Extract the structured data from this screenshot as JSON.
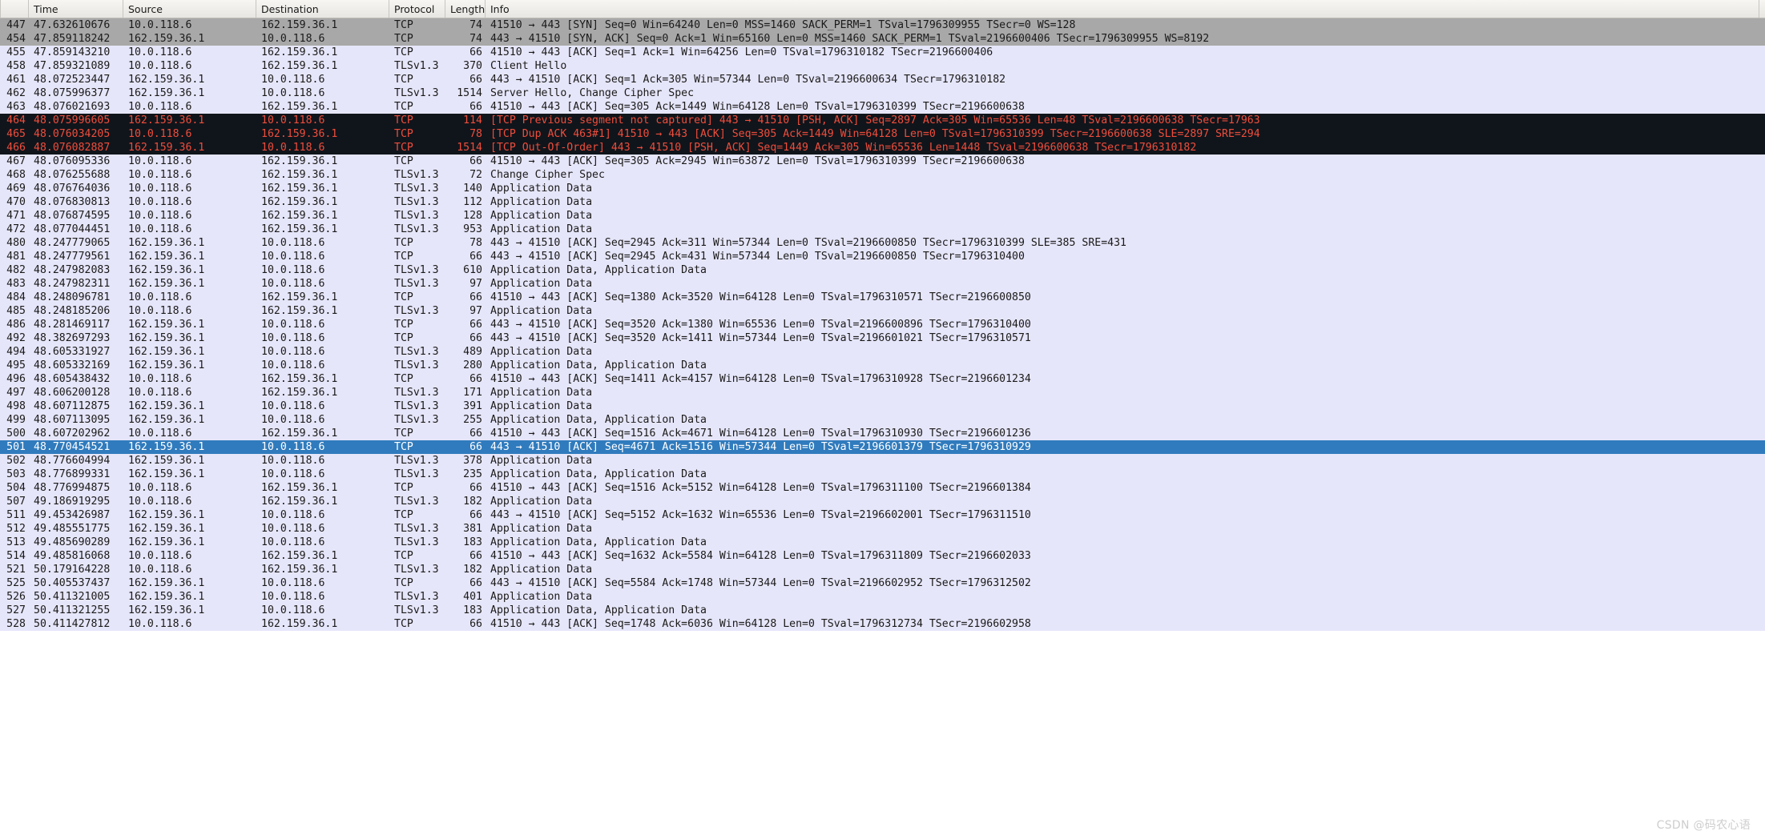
{
  "footer_watermark": "CSDN @码农心语",
  "colors": {
    "default_even": "#ffffff",
    "default_odd": "#ffffff",
    "selected_bg": "#307bbd",
    "selected_fg": "#ffffff",
    "tcp_syn_bg": "#a8a8a8",
    "tcp_syn_fg": "#1a1a1a",
    "tls_bg": "#e6e6fa",
    "tls_fg": "#1a1a1a",
    "tcp_ack_bg": "#e6e6fa",
    "tcp_ack_fg": "#1a1a1a",
    "tcp_err_bg": "#10151b",
    "tcp_err_fg": "#ef4d3c"
  },
  "columns": [
    {
      "label": "",
      "cls": "col-no"
    },
    {
      "label": "Time",
      "cls": "col-time"
    },
    {
      "label": "Source",
      "cls": "col-src"
    },
    {
      "label": "Destination",
      "cls": "col-dst"
    },
    {
      "label": "Protocol",
      "cls": "col-proto"
    },
    {
      "label": "Length",
      "cls": "col-len"
    },
    {
      "label": "Info",
      "cls": "col-info"
    }
  ],
  "packets": [
    {
      "no": 447,
      "time": "47.632610676",
      "src": "10.0.118.6",
      "dst": "162.159.36.1",
      "proto": "TCP",
      "len": 74,
      "info": "41510 → 443 [SYN] Seq=0 Win=64240 Len=0 MSS=1460 SACK_PERM=1 TSval=1796309955 TSecr=0 WS=128",
      "style": "syn"
    },
    {
      "no": 454,
      "time": "47.859118242",
      "src": "162.159.36.1",
      "dst": "10.0.118.6",
      "proto": "TCP",
      "len": 74,
      "info": "443 → 41510 [SYN, ACK] Seq=0 Ack=1 Win=65160 Len=0 MSS=1460 SACK_PERM=1 TSval=2196600406 TSecr=1796309955 WS=8192",
      "style": "syn"
    },
    {
      "no": 455,
      "time": "47.859143210",
      "src": "10.0.118.6",
      "dst": "162.159.36.1",
      "proto": "TCP",
      "len": 66,
      "info": "41510 → 443 [ACK] Seq=1 Ack=1 Win=64256 Len=0 TSval=1796310182 TSecr=2196600406",
      "style": "ack"
    },
    {
      "no": 458,
      "time": "47.859321089",
      "src": "10.0.118.6",
      "dst": "162.159.36.1",
      "proto": "TLSv1.3",
      "len": 370,
      "info": "Client Hello",
      "style": "tls"
    },
    {
      "no": 461,
      "time": "48.072523447",
      "src": "162.159.36.1",
      "dst": "10.0.118.6",
      "proto": "TCP",
      "len": 66,
      "info": "443 → 41510 [ACK] Seq=1 Ack=305 Win=57344 Len=0 TSval=2196600634 TSecr=1796310182",
      "style": "ack"
    },
    {
      "no": 462,
      "time": "48.075996377",
      "src": "162.159.36.1",
      "dst": "10.0.118.6",
      "proto": "TLSv1.3",
      "len": 1514,
      "info": "Server Hello, Change Cipher Spec",
      "style": "tls"
    },
    {
      "no": 463,
      "time": "48.076021693",
      "src": "10.0.118.6",
      "dst": "162.159.36.1",
      "proto": "TCP",
      "len": 66,
      "info": "41510 → 443 [ACK] Seq=305 Ack=1449 Win=64128 Len=0 TSval=1796310399 TSecr=2196600638",
      "style": "ack"
    },
    {
      "no": 464,
      "time": "48.075996605",
      "src": "162.159.36.1",
      "dst": "10.0.118.6",
      "proto": "TCP",
      "len": 114,
      "info": "[TCP Previous segment not captured] 443 → 41510 [PSH, ACK] Seq=2897 Ack=305 Win=65536 Len=48 TSval=2196600638 TSecr=17963",
      "style": "err"
    },
    {
      "no": 465,
      "time": "48.076034205",
      "src": "10.0.118.6",
      "dst": "162.159.36.1",
      "proto": "TCP",
      "len": 78,
      "info": "[TCP Dup ACK 463#1] 41510 → 443 [ACK] Seq=305 Ack=1449 Win=64128 Len=0 TSval=1796310399 TSecr=2196600638 SLE=2897 SRE=294",
      "style": "err"
    },
    {
      "no": 466,
      "time": "48.076082887",
      "src": "162.159.36.1",
      "dst": "10.0.118.6",
      "proto": "TCP",
      "len": 1514,
      "info": "[TCP Out-Of-Order] 443 → 41510 [PSH, ACK] Seq=1449 Ack=305 Win=65536 Len=1448 TSval=2196600638 TSecr=1796310182",
      "style": "err"
    },
    {
      "no": 467,
      "time": "48.076095336",
      "src": "10.0.118.6",
      "dst": "162.159.36.1",
      "proto": "TCP",
      "len": 66,
      "info": "41510 → 443 [ACK] Seq=305 Ack=2945 Win=63872 Len=0 TSval=1796310399 TSecr=2196600638",
      "style": "ack"
    },
    {
      "no": 468,
      "time": "48.076255688",
      "src": "10.0.118.6",
      "dst": "162.159.36.1",
      "proto": "TLSv1.3",
      "len": 72,
      "info": "Change Cipher Spec",
      "style": "tls"
    },
    {
      "no": 469,
      "time": "48.076764036",
      "src": "10.0.118.6",
      "dst": "162.159.36.1",
      "proto": "TLSv1.3",
      "len": 140,
      "info": "Application Data",
      "style": "tls"
    },
    {
      "no": 470,
      "time": "48.076830813",
      "src": "10.0.118.6",
      "dst": "162.159.36.1",
      "proto": "TLSv1.3",
      "len": 112,
      "info": "Application Data",
      "style": "tls"
    },
    {
      "no": 471,
      "time": "48.076874595",
      "src": "10.0.118.6",
      "dst": "162.159.36.1",
      "proto": "TLSv1.3",
      "len": 128,
      "info": "Application Data",
      "style": "tls"
    },
    {
      "no": 472,
      "time": "48.077044451",
      "src": "10.0.118.6",
      "dst": "162.159.36.1",
      "proto": "TLSv1.3",
      "len": 953,
      "info": "Application Data",
      "style": "tls"
    },
    {
      "no": 480,
      "time": "48.247779065",
      "src": "162.159.36.1",
      "dst": "10.0.118.6",
      "proto": "TCP",
      "len": 78,
      "info": "443 → 41510 [ACK] Seq=2945 Ack=311 Win=57344 Len=0 TSval=2196600850 TSecr=1796310399 SLE=385 SRE=431",
      "style": "ack"
    },
    {
      "no": 481,
      "time": "48.247779561",
      "src": "162.159.36.1",
      "dst": "10.0.118.6",
      "proto": "TCP",
      "len": 66,
      "info": "443 → 41510 [ACK] Seq=2945 Ack=431 Win=57344 Len=0 TSval=2196600850 TSecr=1796310400",
      "style": "ack"
    },
    {
      "no": 482,
      "time": "48.247982083",
      "src": "162.159.36.1",
      "dst": "10.0.118.6",
      "proto": "TLSv1.3",
      "len": 610,
      "info": "Application Data, Application Data",
      "style": "tls"
    },
    {
      "no": 483,
      "time": "48.247982311",
      "src": "162.159.36.1",
      "dst": "10.0.118.6",
      "proto": "TLSv1.3",
      "len": 97,
      "info": "Application Data",
      "style": "tls"
    },
    {
      "no": 484,
      "time": "48.248096781",
      "src": "10.0.118.6",
      "dst": "162.159.36.1",
      "proto": "TCP",
      "len": 66,
      "info": "41510 → 443 [ACK] Seq=1380 Ack=3520 Win=64128 Len=0 TSval=1796310571 TSecr=2196600850",
      "style": "ack"
    },
    {
      "no": 485,
      "time": "48.248185206",
      "src": "10.0.118.6",
      "dst": "162.159.36.1",
      "proto": "TLSv1.3",
      "len": 97,
      "info": "Application Data",
      "style": "tls"
    },
    {
      "no": 486,
      "time": "48.281469117",
      "src": "162.159.36.1",
      "dst": "10.0.118.6",
      "proto": "TCP",
      "len": 66,
      "info": "443 → 41510 [ACK] Seq=3520 Ack=1380 Win=65536 Len=0 TSval=2196600896 TSecr=1796310400",
      "style": "ack"
    },
    {
      "no": 492,
      "time": "48.382697293",
      "src": "162.159.36.1",
      "dst": "10.0.118.6",
      "proto": "TCP",
      "len": 66,
      "info": "443 → 41510 [ACK] Seq=3520 Ack=1411 Win=57344 Len=0 TSval=2196601021 TSecr=1796310571",
      "style": "ack"
    },
    {
      "no": 494,
      "time": "48.605331927",
      "src": "162.159.36.1",
      "dst": "10.0.118.6",
      "proto": "TLSv1.3",
      "len": 489,
      "info": "Application Data",
      "style": "tls"
    },
    {
      "no": 495,
      "time": "48.605332169",
      "src": "162.159.36.1",
      "dst": "10.0.118.6",
      "proto": "TLSv1.3",
      "len": 280,
      "info": "Application Data, Application Data",
      "style": "tls"
    },
    {
      "no": 496,
      "time": "48.605438432",
      "src": "10.0.118.6",
      "dst": "162.159.36.1",
      "proto": "TCP",
      "len": 66,
      "info": "41510 → 443 [ACK] Seq=1411 Ack=4157 Win=64128 Len=0 TSval=1796310928 TSecr=2196601234",
      "style": "ack"
    },
    {
      "no": 497,
      "time": "48.606200128",
      "src": "10.0.118.6",
      "dst": "162.159.36.1",
      "proto": "TLSv1.3",
      "len": 171,
      "info": "Application Data",
      "style": "tls"
    },
    {
      "no": 498,
      "time": "48.607112875",
      "src": "162.159.36.1",
      "dst": "10.0.118.6",
      "proto": "TLSv1.3",
      "len": 391,
      "info": "Application Data",
      "style": "tls"
    },
    {
      "no": 499,
      "time": "48.607113095",
      "src": "162.159.36.1",
      "dst": "10.0.118.6",
      "proto": "TLSv1.3",
      "len": 255,
      "info": "Application Data, Application Data",
      "style": "tls"
    },
    {
      "no": 500,
      "time": "48.607202962",
      "src": "10.0.118.6",
      "dst": "162.159.36.1",
      "proto": "TCP",
      "len": 66,
      "info": "41510 → 443 [ACK] Seq=1516 Ack=4671 Win=64128 Len=0 TSval=1796310930 TSecr=2196601236",
      "style": "ack"
    },
    {
      "no": 501,
      "time": "48.770454521",
      "src": "162.159.36.1",
      "dst": "10.0.118.6",
      "proto": "TCP",
      "len": 66,
      "info": "443 → 41510 [ACK] Seq=4671 Ack=1516 Win=57344 Len=0 TSval=2196601379 TSecr=1796310929",
      "style": "ack",
      "selected": true
    },
    {
      "no": 502,
      "time": "48.776604994",
      "src": "162.159.36.1",
      "dst": "10.0.118.6",
      "proto": "TLSv1.3",
      "len": 378,
      "info": "Application Data",
      "style": "tls"
    },
    {
      "no": 503,
      "time": "48.776899331",
      "src": "162.159.36.1",
      "dst": "10.0.118.6",
      "proto": "TLSv1.3",
      "len": 235,
      "info": "Application Data, Application Data",
      "style": "tls"
    },
    {
      "no": 504,
      "time": "48.776994875",
      "src": "10.0.118.6",
      "dst": "162.159.36.1",
      "proto": "TCP",
      "len": 66,
      "info": "41510 → 443 [ACK] Seq=1516 Ack=5152 Win=64128 Len=0 TSval=1796311100 TSecr=2196601384",
      "style": "ack"
    },
    {
      "no": 507,
      "time": "49.186919295",
      "src": "10.0.118.6",
      "dst": "162.159.36.1",
      "proto": "TLSv1.3",
      "len": 182,
      "info": "Application Data",
      "style": "tls"
    },
    {
      "no": 511,
      "time": "49.453426987",
      "src": "162.159.36.1",
      "dst": "10.0.118.6",
      "proto": "TCP",
      "len": 66,
      "info": "443 → 41510 [ACK] Seq=5152 Ack=1632 Win=65536 Len=0 TSval=2196602001 TSecr=1796311510",
      "style": "ack"
    },
    {
      "no": 512,
      "time": "49.485551775",
      "src": "162.159.36.1",
      "dst": "10.0.118.6",
      "proto": "TLSv1.3",
      "len": 381,
      "info": "Application Data",
      "style": "tls"
    },
    {
      "no": 513,
      "time": "49.485690289",
      "src": "162.159.36.1",
      "dst": "10.0.118.6",
      "proto": "TLSv1.3",
      "len": 183,
      "info": "Application Data, Application Data",
      "style": "tls"
    },
    {
      "no": 514,
      "time": "49.485816068",
      "src": "10.0.118.6",
      "dst": "162.159.36.1",
      "proto": "TCP",
      "len": 66,
      "info": "41510 → 443 [ACK] Seq=1632 Ack=5584 Win=64128 Len=0 TSval=1796311809 TSecr=2196602033",
      "style": "ack"
    },
    {
      "no": 521,
      "time": "50.179164228",
      "src": "10.0.118.6",
      "dst": "162.159.36.1",
      "proto": "TLSv1.3",
      "len": 182,
      "info": "Application Data",
      "style": "tls"
    },
    {
      "no": 525,
      "time": "50.405537437",
      "src": "162.159.36.1",
      "dst": "10.0.118.6",
      "proto": "TCP",
      "len": 66,
      "info": "443 → 41510 [ACK] Seq=5584 Ack=1748 Win=57344 Len=0 TSval=2196602952 TSecr=1796312502",
      "style": "ack"
    },
    {
      "no": 526,
      "time": "50.411321005",
      "src": "162.159.36.1",
      "dst": "10.0.118.6",
      "proto": "TLSv1.3",
      "len": 401,
      "info": "Application Data",
      "style": "tls"
    },
    {
      "no": 527,
      "time": "50.411321255",
      "src": "162.159.36.1",
      "dst": "10.0.118.6",
      "proto": "TLSv1.3",
      "len": 183,
      "info": "Application Data, Application Data",
      "style": "tls"
    },
    {
      "no": 528,
      "time": "50.411427812",
      "src": "10.0.118.6",
      "dst": "162.159.36.1",
      "proto": "TCP",
      "len": 66,
      "info": "41510 → 443 [ACK] Seq=1748 Ack=6036 Win=64128 Len=0 TSval=1796312734 TSecr=2196602958",
      "style": "ack"
    }
  ]
}
